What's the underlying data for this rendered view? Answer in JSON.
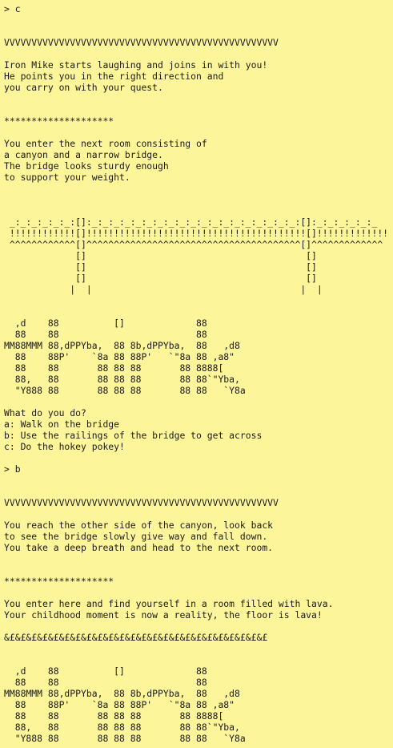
{
  "terminal": {
    "background": "#fdf59a",
    "text_color": "#1a1a1a",
    "lines": [
      "> c",
      "",
      "",
      "VVVVVVVVVVVVVVVVVVVVVVVVVVVVVVVVVVVVVVVVVVVVVVVVVV",
      "",
      "Iron Mike starts laughing and joins in with you!",
      "He points you in the right direction and",
      "you carry on with your quest.",
      "",
      "",
      "********************",
      "",
      "You enter the next room consisting of",
      "a canyon and a narrow bridge.",
      "The bridge looks sturdy enough",
      "to support your weight.",
      "",
      "",
      "",
      " _:_:_:_:_:_:[]:_:_:_:_:_:_:_:_:_:_:_:_:_:_:_:_:_:_:_:[]:_:_:_:_:_:_",
      " !!!!!!!!!!!![]!!!!!!!!!!!!!!!!!!!!!!!!!!!!!!!!!!!!!!!![]!!!!!!!!!!!!!",
      " ^^^^^^^^^^^^[]^^^^^^^^^^^^^^^^^^^^^^^^^^^^^^^^^^^^^^^[]^^^^^^^^^^^^^",
      "             []                                        []",
      "             []                                        []",
      "             []                                        []",
      "            |  |                                      |  |",
      "",
      "",
      "  ,d    88          []             88",
      "  88    88                         88",
      "MM88MMM 88,dPPYba,  88 8b,dPPYba,  88   ,d8",
      "  88    88P'    `8a 88 88P'   `\"8a 88 ,a8\"",
      "  88    88       88 88 88       88 8888[",
      "  88,   88       88 88 88       88 88`\"Yba,",
      "  \"Y888 88       88 88 88       88 88   `Y8a",
      "",
      "What do you do?",
      "a: Walk on the bridge",
      "b: Use the railings of the bridge to get across",
      "c: Do the hokey pokey!",
      "",
      "> b",
      "",
      "",
      "VVVVVVVVVVVVVVVVVVVVVVVVVVVVVVVVVVVVVVVVVVVVVVVVVV",
      "",
      "You reach the other side of the canyon, look back",
      "to see the bridge slowly give way and fall down.",
      "You take a deep breath and head to the next room.",
      "",
      "",
      "********************",
      "",
      "You enter here and find yourself in a room filled with lava.",
      "Your childhood moment is now a reality, the floor is lava!",
      "",
      "&£&£&£&£&£&£&£&£&£&£&£&£&£&£&£&£&£&£&£&£&£&£&£&£",
      "",
      "",
      "  ,d    88          []             88",
      "  88    88                         88",
      "MM88MMM 88,dPPYba,  88 8b,dPPYba,  88   ,d8",
      "  88    88P'    `8a 88 88P'   `\"8a 88 ,a8\"",
      "  88    88       88 88 88       88 8888[",
      "  88,   88       88 88 88       88 88`\"Yba,",
      "  \"Y888 88       88 88 88       88 88   `Y8a"
    ]
  }
}
